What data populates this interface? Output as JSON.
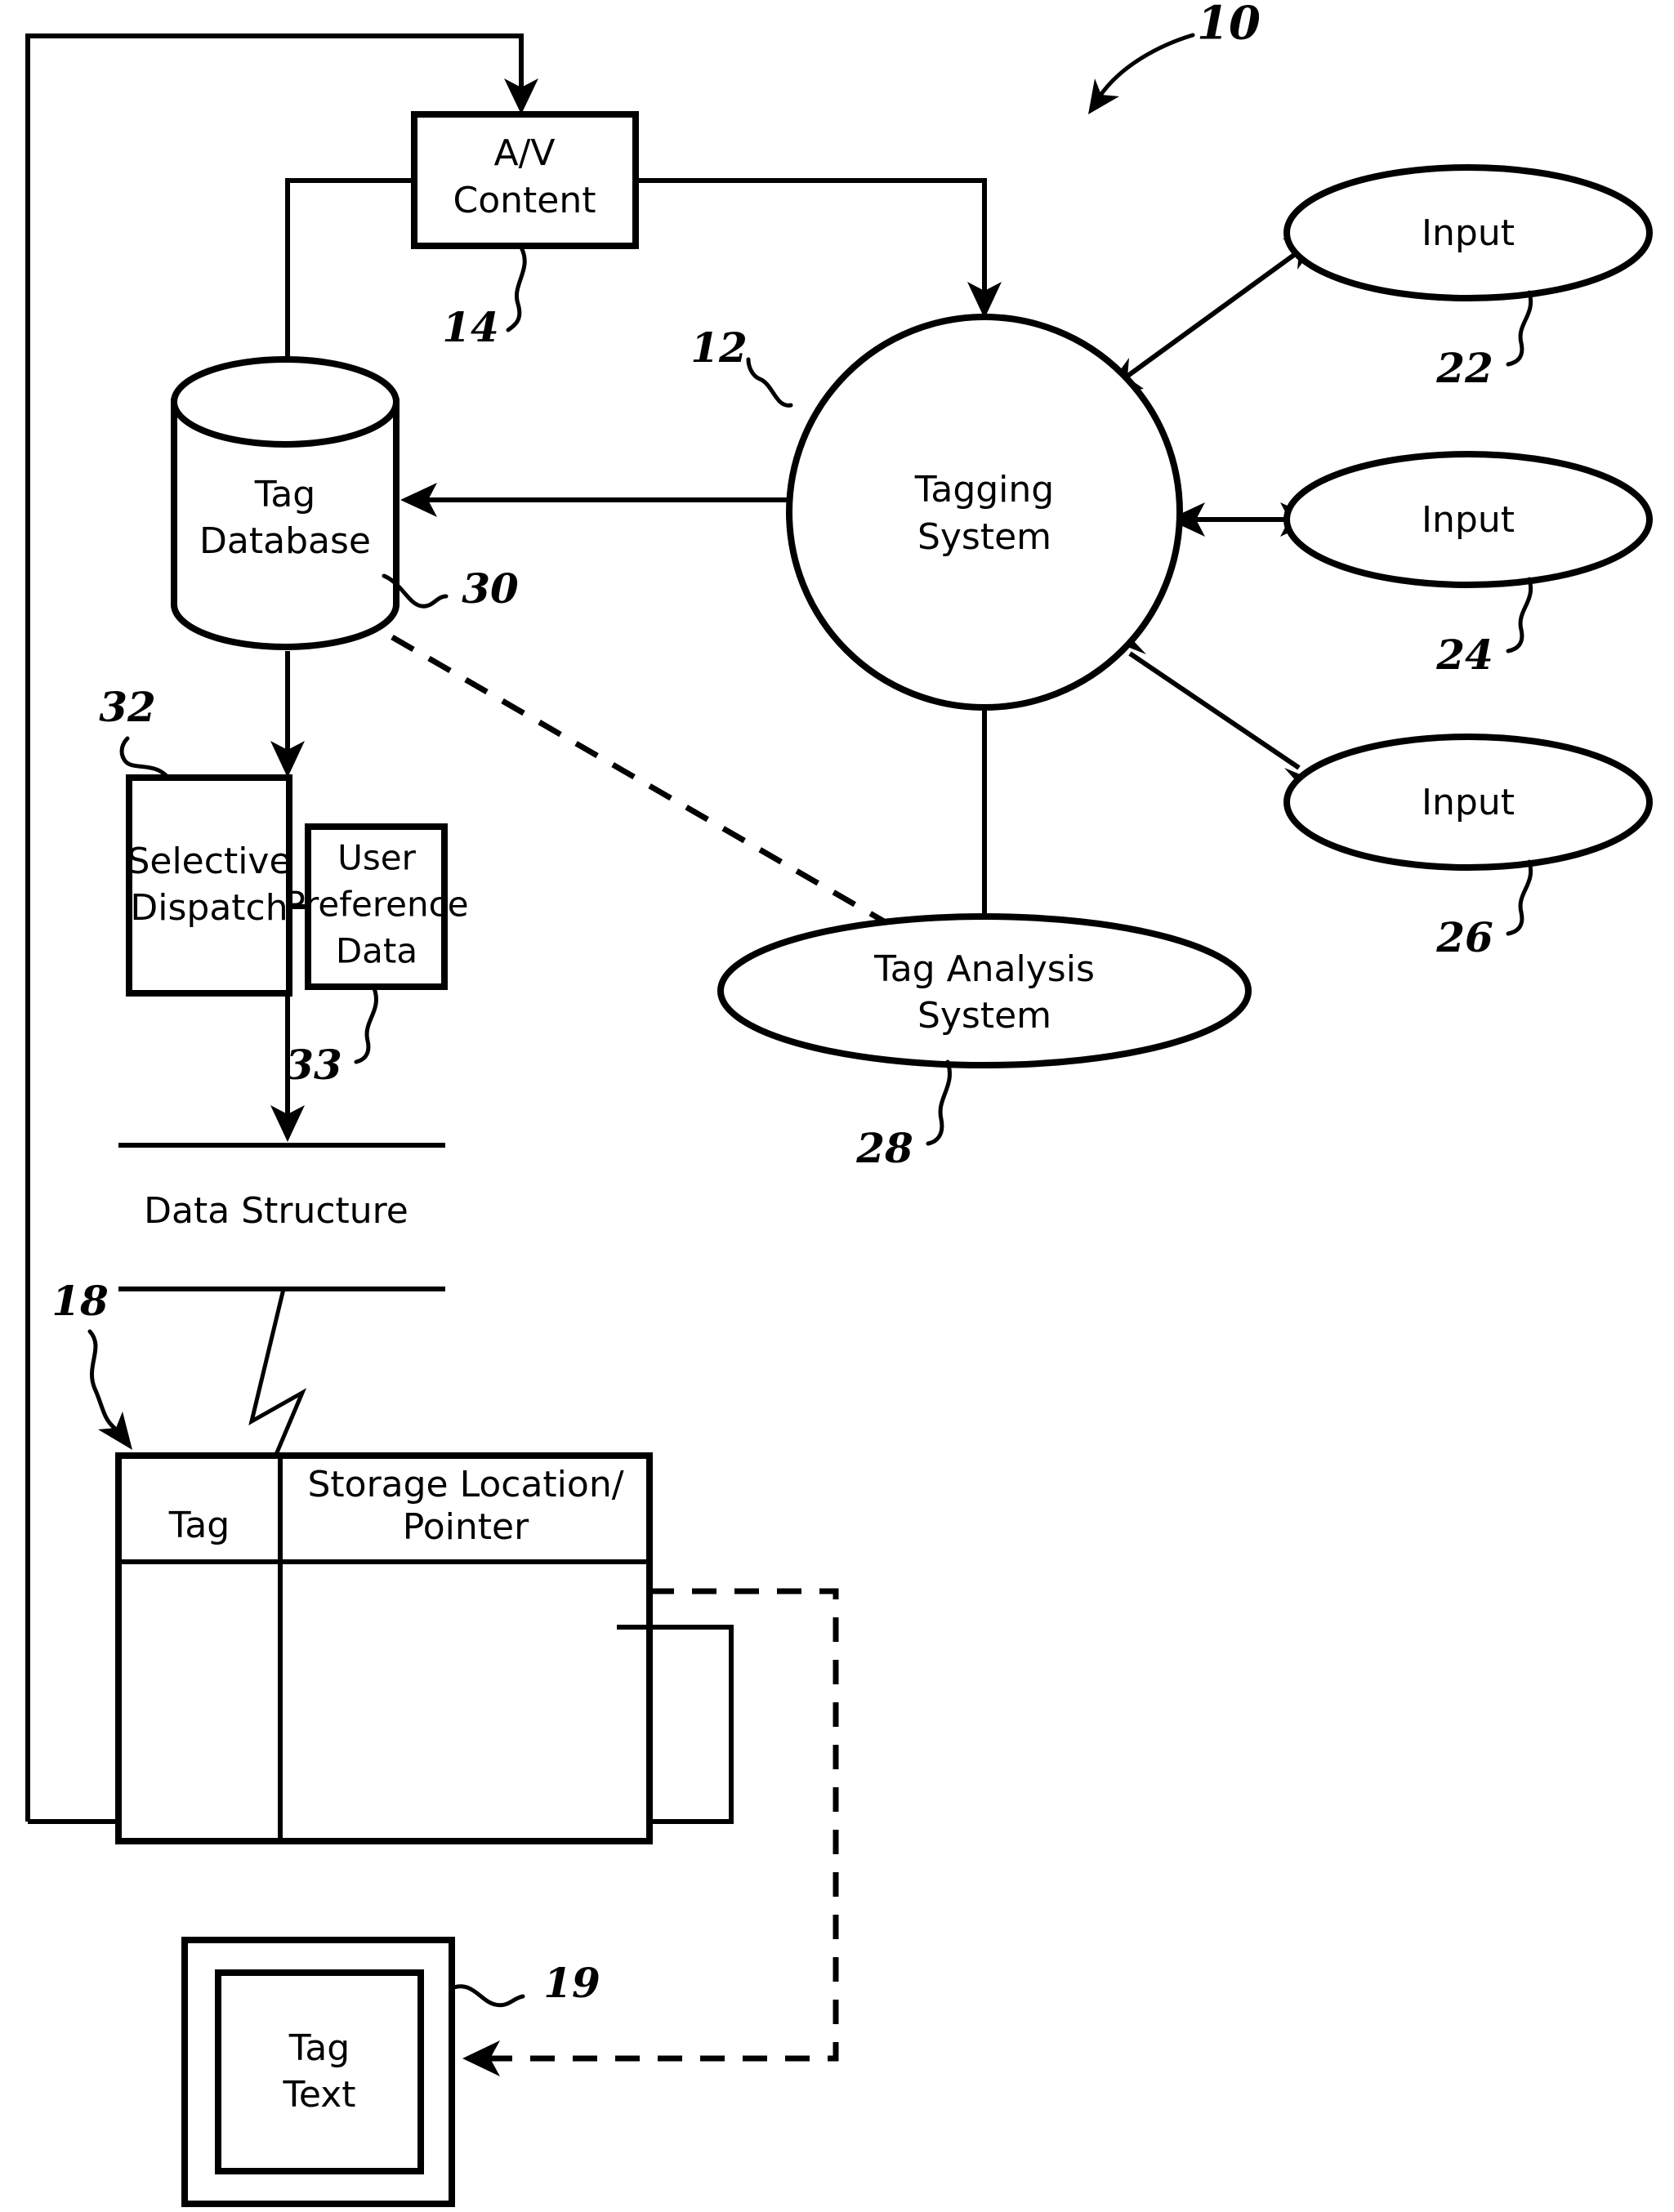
{
  "figure": {
    "type": "patent-block-diagram",
    "figure_reference": "10",
    "background_color": "#ffffff",
    "line_color": "#000000"
  },
  "nodes": {
    "av_content": {
      "label_line1": "A/V",
      "label_line2": "Content",
      "shape": "rectangle",
      "ref": "14"
    },
    "tag_database": {
      "label_line1": "Tag",
      "label_line2": "Database",
      "shape": "cylinder",
      "ref": "30"
    },
    "tagging_system": {
      "label_line1": "Tagging",
      "label_line2": "System",
      "shape": "circle",
      "ref": "12"
    },
    "input_1": {
      "label": "Input",
      "shape": "ellipse",
      "ref": "22"
    },
    "input_2": {
      "label": "Input",
      "shape": "ellipse",
      "ref": "24"
    },
    "input_3": {
      "label": "Input",
      "shape": "ellipse",
      "ref": "26"
    },
    "selective_dispatch": {
      "label_line1": "Selective",
      "label_line2": "Dispatch",
      "shape": "rectangle",
      "ref": "32"
    },
    "user_preference_data": {
      "label_line1": "User",
      "label_line2": "Preference",
      "label_line3": "Data",
      "shape": "rectangle",
      "ref": "33"
    },
    "tag_analysis_system": {
      "label_line1": "Tag Analysis",
      "label_line2": "System",
      "shape": "ellipse",
      "ref": "28"
    },
    "data_structure": {
      "label": "Data Structure",
      "shape": "break-band"
    },
    "tag_table": {
      "ref": "18",
      "columns": [
        "Tag",
        "Storage Location/\nPointer"
      ],
      "column_headers": [
        {
          "text": "Tag"
        },
        {
          "text_line1": "Storage Location/",
          "text_line2": "Pointer"
        }
      ],
      "rows": [
        {
          "tag": "",
          "storage": ""
        }
      ]
    },
    "tag_text": {
      "label_line1": "Tag",
      "label_line2": "Text",
      "shape": "nested-rectangle",
      "ref": "19"
    }
  },
  "reference_numerals": {
    "n10": "10",
    "n12": "12",
    "n14": "14",
    "n18": "18",
    "n19": "19",
    "n22": "22",
    "n24": "24",
    "n26": "26",
    "n28": "28",
    "n30": "30",
    "n32": "32",
    "n33": "33"
  }
}
